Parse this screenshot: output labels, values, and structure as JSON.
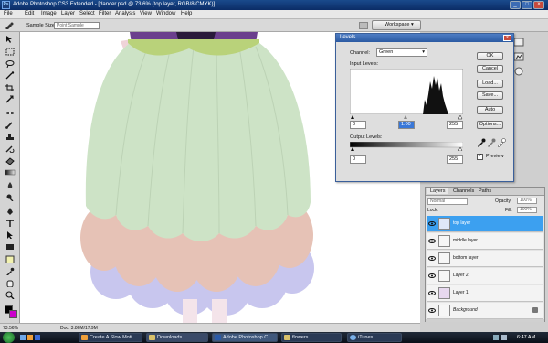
{
  "window": {
    "title": "Adobe Photoshop CS3 Extended - [dancer.psd @ 73.6% (top layer, RGB/8/CMYK)]",
    "logo": "Ps"
  },
  "menubar": {
    "items": [
      "File",
      "Edit",
      "Image",
      "Layer",
      "Select",
      "Filter",
      "Analysis",
      "View",
      "Window",
      "Help"
    ]
  },
  "optionsbar": {
    "sample_size_label": "Sample Size:",
    "sample_size_value": "Point Sample",
    "workspace_label": "Workspace"
  },
  "toolbox": {
    "tools": [
      "move-tool",
      "marquee-tool",
      "lasso-tool",
      "magic-wand-tool",
      "crop-tool",
      "slice-tool",
      "healing-brush-tool",
      "brush-tool",
      "clone-stamp-tool",
      "history-brush-tool",
      "eraser-tool",
      "gradient-tool",
      "blur-tool",
      "dodge-tool",
      "pen-tool",
      "type-tool",
      "path-selection-tool",
      "shape-tool",
      "notes-tool",
      "eyedropper-tool",
      "hand-tool",
      "zoom-tool"
    ]
  },
  "statusbar": {
    "zoom": "73.56%",
    "doc": "Doc: 3.86M/17.9M"
  },
  "levels_dialog": {
    "title": "Levels",
    "channel_label": "Channel:",
    "channel_value": "Green",
    "input_levels_label": "Input Levels:",
    "input_values": [
      "0",
      "1.00",
      "255"
    ],
    "output_levels_label": "Output Levels:",
    "output_values": [
      "0",
      "255"
    ],
    "buttons": [
      "OK",
      "Cancel",
      "Load...",
      "Save...",
      "Auto",
      "Options..."
    ],
    "preview_label": "Preview",
    "preview_checked": true
  },
  "layers_panel": {
    "tabs": [
      "Layers",
      "Channels",
      "Paths"
    ],
    "blend_mode": "Normal",
    "opacity_label": "Opacity:",
    "opacity_value": "100%",
    "lock_label": "Lock:",
    "fill_label": "Fill:",
    "fill_value": "100%",
    "layers": [
      {
        "name": "top layer",
        "selected": true
      },
      {
        "name": "middle layer",
        "selected": false
      },
      {
        "name": "bottom layer",
        "selected": false
      },
      {
        "name": "Layer 2",
        "selected": false
      },
      {
        "name": "Layer 1",
        "selected": false
      },
      {
        "name": "Background",
        "selected": false
      }
    ]
  },
  "taskbar": {
    "tasks": [
      "Create A Slow Moti...",
      "Downloads",
      "Adobe Photoshop C...",
      "flowers",
      "iTunes"
    ],
    "time": "6:47 AM"
  },
  "colors": {
    "skirt_green": "#cde3c6",
    "petal_pink": "#e6c2b6",
    "petal_lavender": "#c8c6ee",
    "selected_layer": "#3ca0f0",
    "fg_color": "#000000",
    "bg_color": "#cc00cc"
  }
}
